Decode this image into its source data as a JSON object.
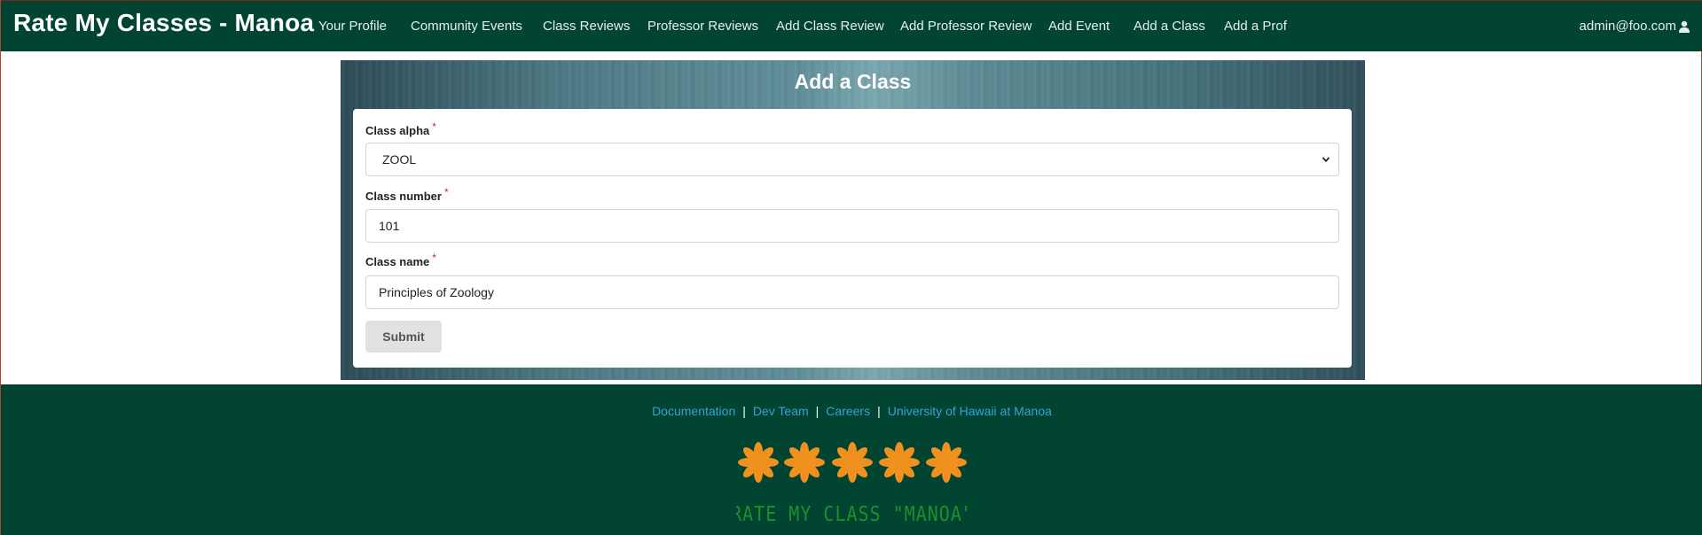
{
  "navbar": {
    "brand": "Rate My Classes - Manoa",
    "links": [
      "Your Profile",
      "Community Events",
      "Class Reviews",
      "Professor Reviews",
      "Add Class Review",
      "Add Professor Review",
      "Add Event",
      "Add a Class",
      "Add a Prof"
    ],
    "user": "admin@foo.com",
    "user_icon": "user-icon"
  },
  "form": {
    "title": "Add a Class",
    "required_mark": "*",
    "class_alpha": {
      "label": "Class alpha",
      "value": "ZOOL"
    },
    "class_number": {
      "label": "Class number",
      "value": "101"
    },
    "class_name": {
      "label": "Class name",
      "value": "Principles of Zoology"
    },
    "submit_label": "Submit"
  },
  "footer": {
    "links": [
      "Documentation",
      "Dev Team",
      "Careers",
      "University of Hawaii at Manoa"
    ],
    "separator": "|",
    "logo_text": "RATE MY CLASS \"MANOA\""
  },
  "colors": {
    "nav_bg": "#004431",
    "footer_bg": "#004431",
    "link": "#3aa0d8",
    "logo_asterisk": "#f0901e",
    "logo_text": "#1e8f2a"
  }
}
